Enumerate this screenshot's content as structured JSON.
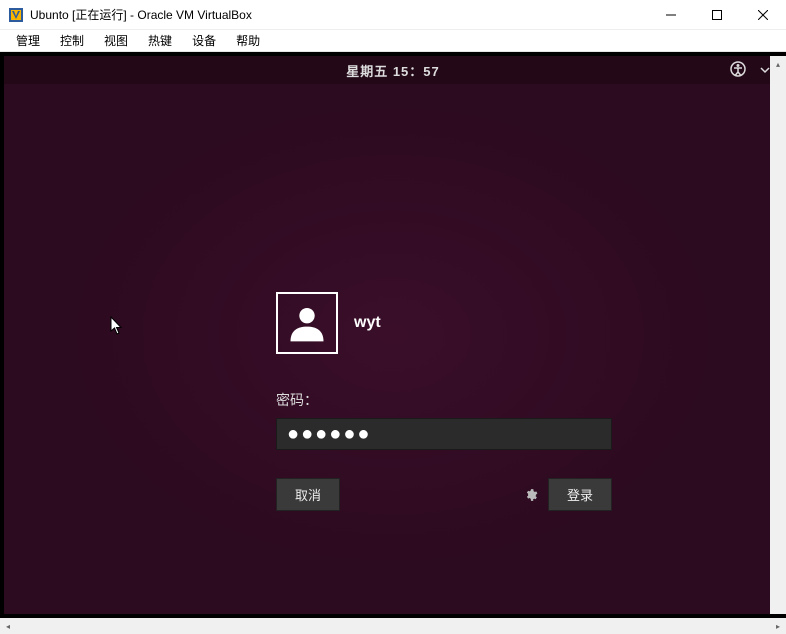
{
  "window": {
    "title": "Ubunto [正在运行] - Oracle VM VirtualBox"
  },
  "menubar": {
    "items": [
      "管理",
      "控制",
      "视图",
      "热键",
      "设备",
      "帮助"
    ]
  },
  "top_panel": {
    "datetime": "星期五 15：57"
  },
  "login": {
    "username": "wyt",
    "password_label": "密码：",
    "password_value": "●●●●●●",
    "cancel_label": "取消",
    "login_label": "登录"
  }
}
